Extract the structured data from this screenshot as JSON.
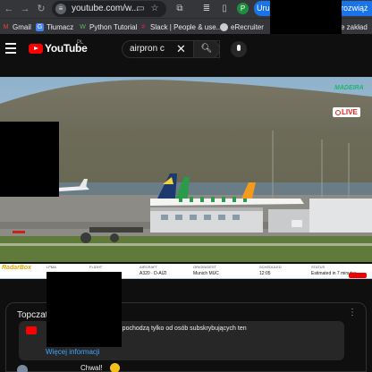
{
  "browser": {
    "url": "youtube.com/w...",
    "profile_initial": "P",
    "restart_label": "Uruch",
    "restart_tail": "rozwiąż"
  },
  "bookmarks": [
    {
      "label": "Gmail"
    },
    {
      "label": "Tłumacz"
    },
    {
      "label": "Python Tutorial"
    },
    {
      "label": "Slack | People & use..."
    },
    {
      "label": "eRecruiter"
    },
    {
      "label": "e zakład"
    }
  ],
  "youtube": {
    "logo_text": "YouTube",
    "region": "PL",
    "search_value": "airpron c",
    "search_icon": "search-icon",
    "mic_icon": "mic-icon"
  },
  "video": {
    "channel_logo": "MADEIRA",
    "live_label": "LIVE"
  },
  "flight_info": {
    "provider": "RadarBox",
    "columns": [
      "LPMA",
      "",
      "FLIGHT",
      "AIRCRAFT",
      "ORIGIN/DEST",
      "SCHEDULED",
      "STATUS"
    ],
    "values": [
      "",
      "",
      "",
      "A320 · D-AIZI",
      "Munich MUC",
      "12:05",
      "Estimated in 7 minutes"
    ]
  },
  "chat": {
    "title": "Topczat",
    "notice_text": "Wyświetlane wiadomości pochodzą tylko od osób subskrybujących ten",
    "notice_link": "Więcej informacji",
    "message_text": "Chwal!",
    "menu_icon": "more-vert-icon"
  },
  "colors": {
    "youtube_red": "#ff0000",
    "chrome_bar": "#35363a",
    "madeira_green": "#22b573",
    "live_red": "#e62117"
  }
}
